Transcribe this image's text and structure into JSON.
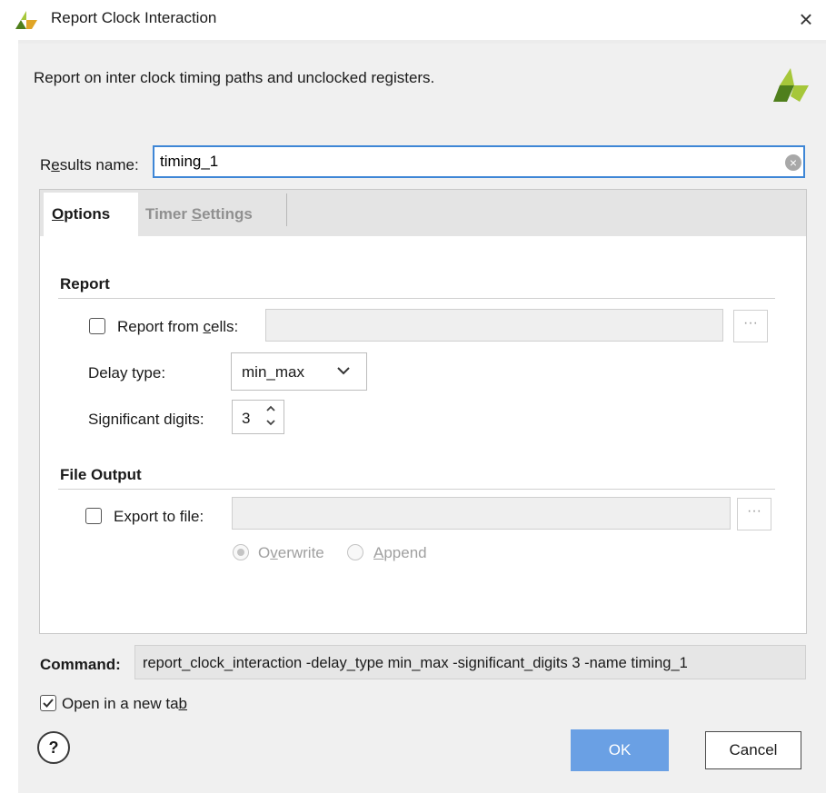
{
  "window": {
    "title": "Report Clock Interaction",
    "close_label": "×",
    "description": "Report on inter clock timing paths and unclocked registers."
  },
  "results": {
    "label_pre": "R",
    "label_underlined": "e",
    "label_post": "sults name:",
    "value": "timing_1"
  },
  "tabs": [
    {
      "label_underlined": "O",
      "label_post": "ptions",
      "active": true
    },
    {
      "label_pre": "Timer ",
      "label_underlined": "S",
      "label_post": "ettings",
      "active": false
    }
  ],
  "report_section": {
    "title": "Report",
    "report_from_cells": {
      "label_pre": "Report from ",
      "label_underlined": "c",
      "label_post": "ells:",
      "checked": false,
      "value": ""
    },
    "delay_type": {
      "label": "Delay type:",
      "value": "min_max"
    },
    "significant_digits": {
      "label": "Significant digits:",
      "value": "3"
    }
  },
  "file_output_section": {
    "title": "File Output",
    "export_to_file": {
      "label": "Export to file:",
      "checked": false,
      "value": ""
    },
    "radios": [
      {
        "label_pre": "O",
        "label_underlined": "v",
        "label_post": "erwrite",
        "selected": true
      },
      {
        "label_pre": "",
        "label_underlined": "A",
        "label_post": "ppend",
        "selected": false
      }
    ]
  },
  "command": {
    "label": "Command:",
    "text": "report_clock_interaction -delay_type min_max -significant_digits 3 -name timing_1"
  },
  "open_in_new_tab": {
    "label_pre": "Open in a new ta",
    "label_underlined": "b",
    "checked": true
  },
  "buttons": {
    "help": "?",
    "ok": "OK",
    "cancel": "Cancel",
    "browse": "···"
  },
  "colors": {
    "accent": "#3e86d6",
    "ok_button": "#6aa0e4",
    "logo_dark": "#4f7f1c",
    "logo_light": "#a6c73a"
  }
}
